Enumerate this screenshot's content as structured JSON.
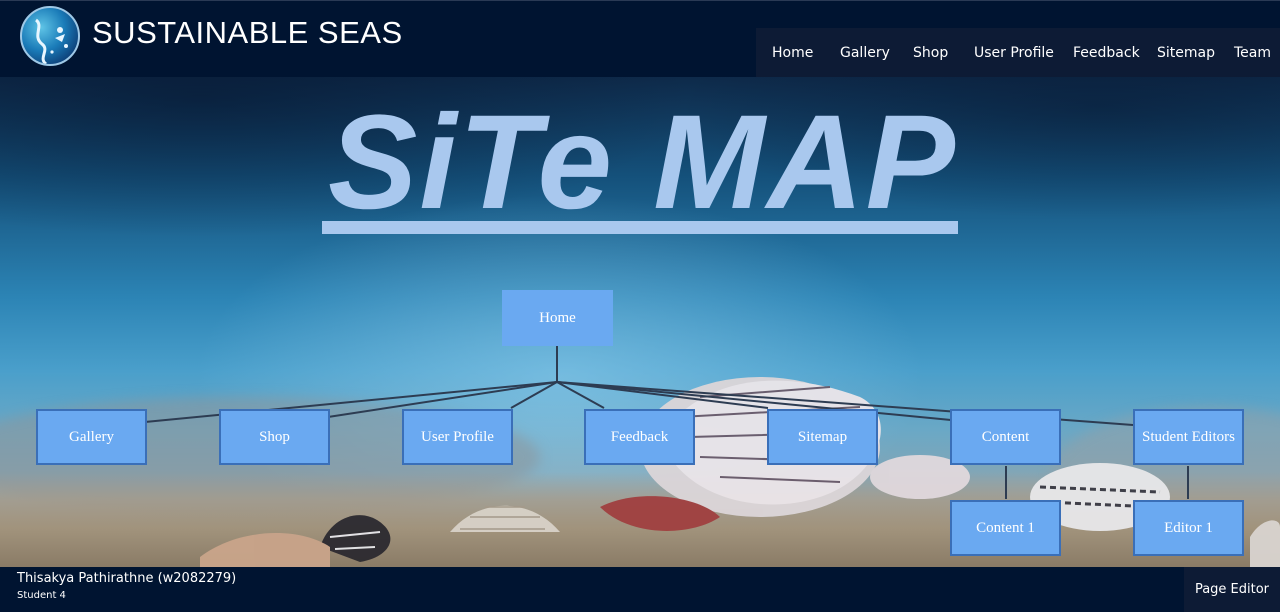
{
  "header": {
    "brand": "SUSTAINABLE SEAS",
    "logo_icon": "sea-creature-globe-logo",
    "nav": [
      "Home",
      "Gallery",
      "Shop",
      "User Profile",
      "Feedback",
      "Sitemap",
      "Team"
    ]
  },
  "hero": {
    "title": "SiTe MAP"
  },
  "sitemap": {
    "root": "Home",
    "children": [
      "Gallery",
      "Shop",
      "User Profile",
      "Feedback",
      "Sitemap",
      "Content",
      "Student Editors"
    ],
    "content_child": "Content 1",
    "editors_child": "Editor 1"
  },
  "footer": {
    "student_name": "Thisakya Pathirathne (w2082279)",
    "student_role": "Student 4",
    "page_editor": "Page Editor"
  },
  "colors": {
    "header_bg": "#001431",
    "nav_bg": "#0d1b35",
    "node_bg": "#6aa9f1",
    "node_border": "#3a6fb8",
    "title_color": "#a9c8ee"
  }
}
